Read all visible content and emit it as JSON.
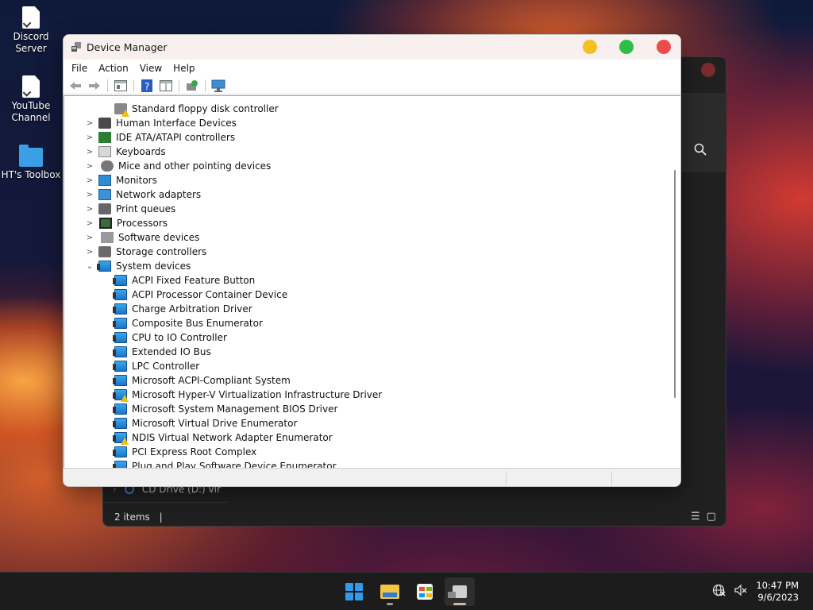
{
  "desktop": {
    "icons": [
      {
        "label": "Discord Server",
        "icon": "file-icon"
      },
      {
        "label": "YouTube Channel",
        "icon": "file-icon"
      },
      {
        "label": "HT's Toolbox",
        "icon": "folder-icon"
      }
    ]
  },
  "explorer": {
    "drive_label": "CD Drive (D:) vir",
    "status_text": "2 items",
    "search_icon": "search-icon"
  },
  "device_manager": {
    "title": "Device Manager",
    "menu": [
      "File",
      "Action",
      "View",
      "Help"
    ],
    "toolbar": [
      "back-icon",
      "forward-icon",
      "properties-pane-icon",
      "help-icon",
      "show-hidden-icon",
      "scan-hardware-icon",
      "computer-monitor-icon"
    ],
    "tree": [
      {
        "label": "Standard floppy disk controller",
        "level": 1,
        "icon": "controller-warning-icon",
        "warning": true
      },
      {
        "label": "Human Interface Devices",
        "level": 0,
        "icon": "hid-icon",
        "expander": "collapsed"
      },
      {
        "label": "IDE ATA/ATAPI controllers",
        "level": 0,
        "icon": "ide-icon",
        "expander": "collapsed"
      },
      {
        "label": "Keyboards",
        "level": 0,
        "icon": "keyboard-icon",
        "expander": "collapsed"
      },
      {
        "label": "Mice and other pointing devices",
        "level": 0,
        "icon": "mouse-icon",
        "expander": "collapsed"
      },
      {
        "label": "Monitors",
        "level": 0,
        "icon": "monitor-icon",
        "expander": "collapsed"
      },
      {
        "label": "Network adapters",
        "level": 0,
        "icon": "network-icon",
        "expander": "collapsed"
      },
      {
        "label": "Print queues",
        "level": 0,
        "icon": "printer-icon",
        "expander": "collapsed"
      },
      {
        "label": "Processors",
        "level": 0,
        "icon": "processor-icon",
        "expander": "collapsed"
      },
      {
        "label": "Software devices",
        "level": 0,
        "icon": "software-device-icon",
        "expander": "collapsed"
      },
      {
        "label": "Storage controllers",
        "level": 0,
        "icon": "storage-icon",
        "expander": "collapsed"
      },
      {
        "label": "System devices",
        "level": 0,
        "icon": "system-icon",
        "expander": "expanded"
      },
      {
        "label": "ACPI Fixed Feature Button",
        "level": 1,
        "icon": "system-device-icon"
      },
      {
        "label": "ACPI Processor Container Device",
        "level": 1,
        "icon": "system-device-icon"
      },
      {
        "label": "Charge Arbitration Driver",
        "level": 1,
        "icon": "system-device-icon"
      },
      {
        "label": "Composite Bus Enumerator",
        "level": 1,
        "icon": "system-device-icon"
      },
      {
        "label": "CPU to IO Controller",
        "level": 1,
        "icon": "system-device-icon"
      },
      {
        "label": "Extended IO Bus",
        "level": 1,
        "icon": "system-device-icon"
      },
      {
        "label": "LPC Controller",
        "level": 1,
        "icon": "system-device-icon"
      },
      {
        "label": "Microsoft ACPI-Compliant System",
        "level": 1,
        "icon": "system-device-icon"
      },
      {
        "label": "Microsoft Hyper-V Virtualization Infrastructure Driver",
        "level": 1,
        "icon": "system-device-warning-icon",
        "warning": true
      },
      {
        "label": "Microsoft System Management BIOS Driver",
        "level": 1,
        "icon": "system-device-icon"
      },
      {
        "label": "Microsoft Virtual Drive Enumerator",
        "level": 1,
        "icon": "system-device-icon"
      },
      {
        "label": "NDIS Virtual Network Adapter Enumerator",
        "level": 1,
        "icon": "system-device-warning-icon",
        "warning": true
      },
      {
        "label": "PCI Express Root Complex",
        "level": 1,
        "icon": "system-device-icon"
      },
      {
        "label": "Plug and Play Software Device Enumerator",
        "level": 1,
        "icon": "system-device-icon"
      }
    ]
  },
  "taskbar": {
    "apps": [
      "start-icon",
      "file-explorer-icon",
      "store-icon",
      "device-manager-icon"
    ],
    "tray": [
      "network-icon",
      "volume-muted-icon"
    ],
    "time": "10:47 PM",
    "date": "9/6/2023"
  },
  "colors": {
    "minimize": "#f5c023",
    "maximize": "#2dbe4a",
    "close": "#ee4b4b",
    "accent": "#2f9bea"
  }
}
